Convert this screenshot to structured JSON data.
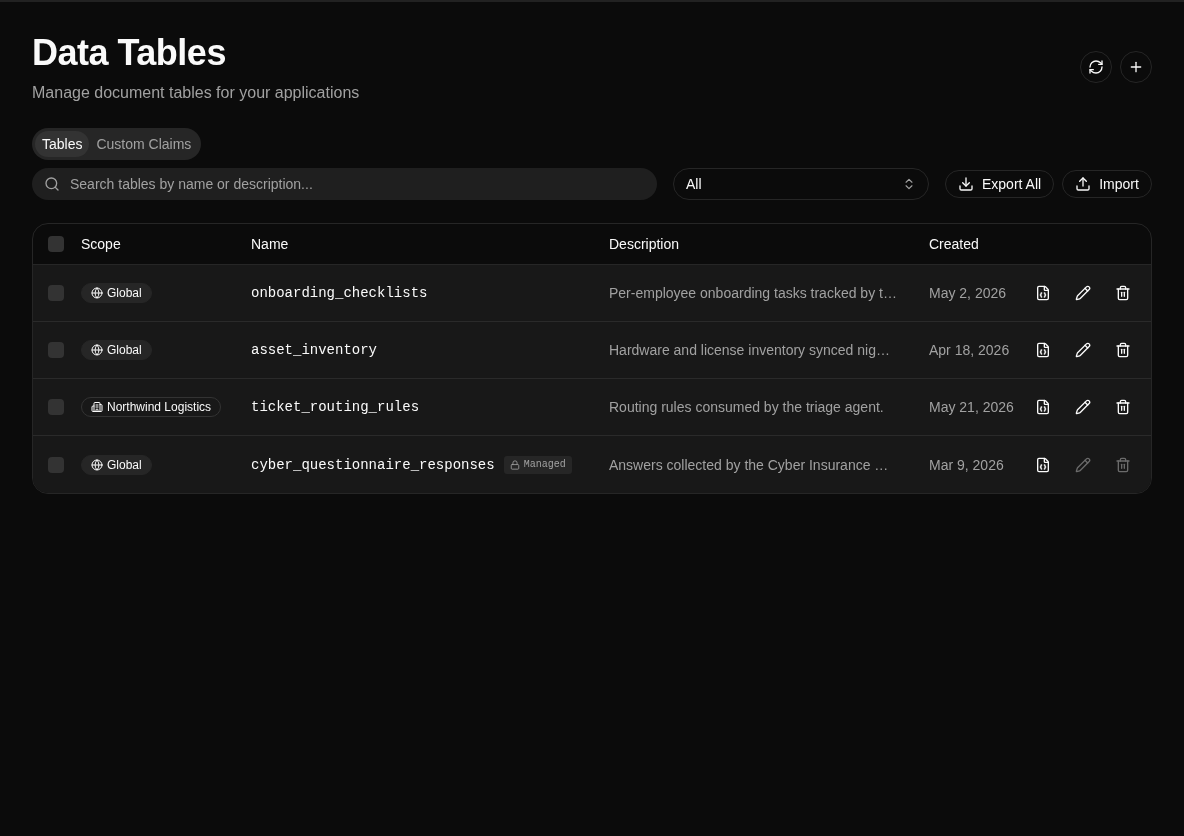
{
  "header": {
    "title": "Data Tables",
    "subtitle": "Manage document tables for your applications"
  },
  "tabs": [
    {
      "label": "Tables",
      "selected": true
    },
    {
      "label": "Custom Claims",
      "selected": false
    }
  ],
  "search": {
    "placeholder": "Search tables by name or description..."
  },
  "filter": {
    "value": "All"
  },
  "buttons": [
    "Export All",
    "Import"
  ],
  "table": {
    "select_all": {
      "checked": false
    },
    "columns": [
      "Scope",
      "Name",
      "Description",
      "Created"
    ],
    "rows": [
      {
        "checked": false,
        "scope": {
          "kind": "global",
          "label": "Global"
        },
        "name": "onboarding_checklists",
        "description": "Per-employee onboarding tasks tracked by t…",
        "created": "May 2, 2026",
        "disabled_actions": false
      },
      {
        "checked": false,
        "scope": {
          "kind": "global",
          "label": "Global"
        },
        "name": "asset_inventory",
        "description": "Hardware and license inventory synced nig…",
        "created": "Apr 18, 2026",
        "disabled_actions": false
      },
      {
        "checked": false,
        "scope": {
          "kind": "org",
          "label": "Northwind Logistics"
        },
        "name": "ticket_routing_rules",
        "description": "Routing rules consumed by the triage agent.",
        "created": "May 21, 2026",
        "disabled_actions": false
      },
      {
        "checked": false,
        "scope": {
          "kind": "global",
          "label": "Global"
        },
        "name": "cyber_questionnaire_responses",
        "badge": "Managed",
        "description": "Answers collected by the Cyber Insurance …",
        "created": "Mar 9, 2026",
        "disabled_actions": true
      }
    ]
  }
}
